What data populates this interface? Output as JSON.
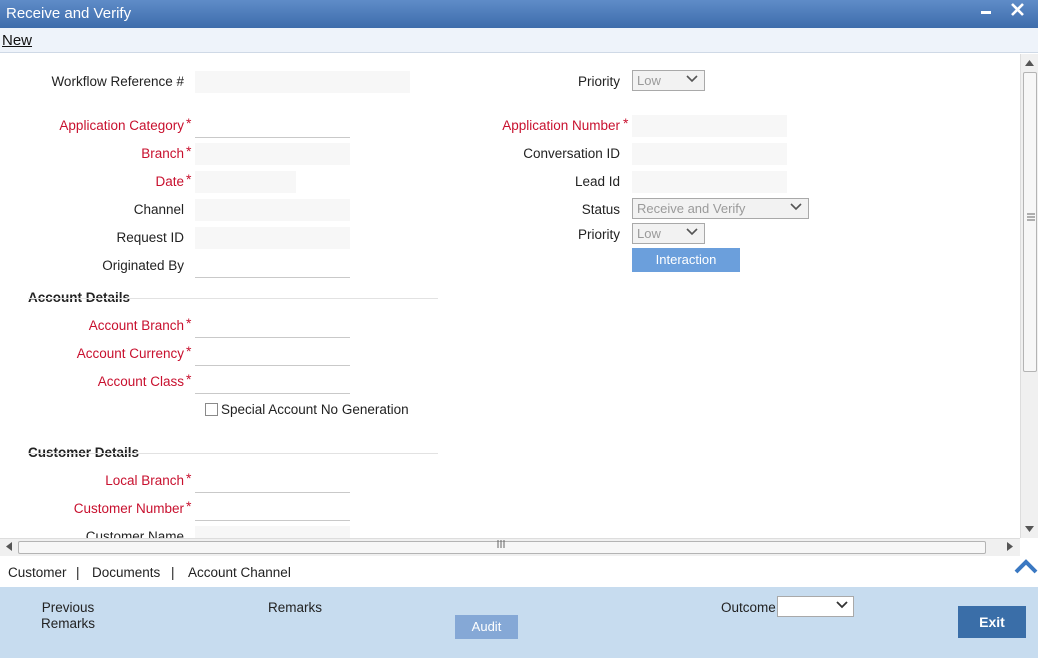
{
  "window": {
    "title": "Receive and Verify",
    "minimize": "▬",
    "close": "✕"
  },
  "menu": {
    "new": "New"
  },
  "form": {
    "workflow_ref": {
      "label": "Workflow Reference #",
      "value": ""
    },
    "priority_top": {
      "label": "Priority",
      "value": "Low"
    },
    "application_category": {
      "label": "Application Category",
      "value": ""
    },
    "application_number": {
      "label": "Application Number",
      "value": ""
    },
    "branch": {
      "label": "Branch",
      "value": ""
    },
    "conversation_id": {
      "label": "Conversation ID",
      "value": ""
    },
    "date": {
      "label": "Date",
      "value": ""
    },
    "lead_id": {
      "label": "Lead Id",
      "value": ""
    },
    "channel": {
      "label": "Channel",
      "value": ""
    },
    "status": {
      "label": "Status",
      "value": "Receive and Verify"
    },
    "request_id": {
      "label": "Request ID",
      "value": ""
    },
    "priority": {
      "label": "Priority",
      "value": "Low"
    },
    "originated_by": {
      "label": "Originated By",
      "value": ""
    },
    "interaction_button": "Interaction",
    "required_mark": "*"
  },
  "account_details": {
    "heading": "Account Details",
    "account_branch": {
      "label": "Account Branch",
      "value": ""
    },
    "account_currency": {
      "label": "Account Currency",
      "value": ""
    },
    "account_class": {
      "label": "Account Class",
      "value": ""
    },
    "special_account": {
      "label": "Special Account No Generation",
      "checked": false
    }
  },
  "customer_details": {
    "heading": "Customer Details",
    "local_branch": {
      "label": "Local Branch",
      "value": ""
    },
    "customer_number": {
      "label": "Customer Number",
      "value": ""
    },
    "customer_name": {
      "label": "Customer Name",
      "value": ""
    }
  },
  "tabs": {
    "items": [
      "Customer",
      "Documents",
      "Account Channel"
    ],
    "separator": "|"
  },
  "footer": {
    "previous_remarks": "Previous\nRemarks",
    "previous_remarks_line1": "Previous",
    "previous_remarks_line2": "Remarks",
    "remarks": "Remarks",
    "audit": "Audit",
    "outcome_label": "Outcome",
    "outcome_value": "",
    "exit": "Exit"
  },
  "colors": {
    "titlebar": "#4a7abb",
    "required": "#c8102e",
    "footer": "#c7dcef",
    "exit_button": "#3a6ea8",
    "interaction_button": "#6b9fdc"
  }
}
